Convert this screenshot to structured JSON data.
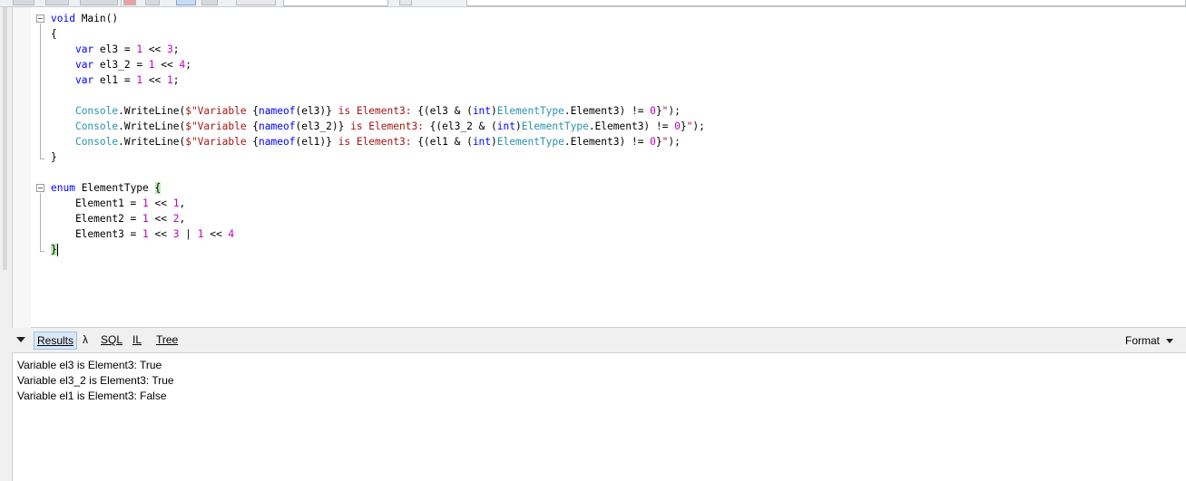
{
  "editor": {
    "lines": [
      {
        "parts": [
          {
            "t": "void",
            "c": "kw"
          },
          {
            "t": " Main()"
          }
        ]
      },
      {
        "parts": [
          {
            "t": "{"
          }
        ]
      },
      {
        "parts": [
          {
            "t": "    "
          },
          {
            "t": "var",
            "c": "kw"
          },
          {
            "t": " el3 = "
          },
          {
            "t": "1",
            "c": "num"
          },
          {
            "t": " << "
          },
          {
            "t": "3",
            "c": "num"
          },
          {
            "t": ";"
          }
        ]
      },
      {
        "parts": [
          {
            "t": "    "
          },
          {
            "t": "var",
            "c": "kw"
          },
          {
            "t": " el3_2 = "
          },
          {
            "t": "1",
            "c": "num"
          },
          {
            "t": " << "
          },
          {
            "t": "4",
            "c": "num"
          },
          {
            "t": ";"
          }
        ]
      },
      {
        "parts": [
          {
            "t": "    "
          },
          {
            "t": "var",
            "c": "kw"
          },
          {
            "t": " el1 = "
          },
          {
            "t": "1",
            "c": "num"
          },
          {
            "t": " << "
          },
          {
            "t": "1",
            "c": "num"
          },
          {
            "t": ";"
          }
        ]
      },
      {
        "parts": []
      },
      {
        "parts": [
          {
            "t": "    "
          },
          {
            "t": "Console",
            "c": "ty"
          },
          {
            "t": ".WriteLine("
          },
          {
            "t": "$\"Variable ",
            "c": "str"
          },
          {
            "t": "{"
          },
          {
            "t": "nameof",
            "c": "kw"
          },
          {
            "t": "(el3)}"
          },
          {
            "t": " is Element3: ",
            "c": "str"
          },
          {
            "t": "{(el3 & ("
          },
          {
            "t": "int",
            "c": "kw"
          },
          {
            "t": ")"
          },
          {
            "t": "ElementType",
            "c": "ty"
          },
          {
            "t": ".Element3) != "
          },
          {
            "t": "0",
            "c": "num"
          },
          {
            "t": "}"
          },
          {
            "t": "\"",
            "c": "str"
          },
          {
            "t": ");"
          }
        ]
      },
      {
        "parts": [
          {
            "t": "    "
          },
          {
            "t": "Console",
            "c": "ty"
          },
          {
            "t": ".WriteLine("
          },
          {
            "t": "$\"Variable ",
            "c": "str"
          },
          {
            "t": "{"
          },
          {
            "t": "nameof",
            "c": "kw"
          },
          {
            "t": "(el3_2)}"
          },
          {
            "t": " is Element3: ",
            "c": "str"
          },
          {
            "t": "{(el3_2 & ("
          },
          {
            "t": "int",
            "c": "kw"
          },
          {
            "t": ")"
          },
          {
            "t": "ElementType",
            "c": "ty"
          },
          {
            "t": ".Element3) != "
          },
          {
            "t": "0",
            "c": "num"
          },
          {
            "t": "}"
          },
          {
            "t": "\"",
            "c": "str"
          },
          {
            "t": ");"
          }
        ]
      },
      {
        "parts": [
          {
            "t": "    "
          },
          {
            "t": "Console",
            "c": "ty"
          },
          {
            "t": ".WriteLine("
          },
          {
            "t": "$\"Variable ",
            "c": "str"
          },
          {
            "t": "{"
          },
          {
            "t": "nameof",
            "c": "kw"
          },
          {
            "t": "(el1)}"
          },
          {
            "t": " is Element3: ",
            "c": "str"
          },
          {
            "t": "{(el1 & ("
          },
          {
            "t": "int",
            "c": "kw"
          },
          {
            "t": ")"
          },
          {
            "t": "ElementType",
            "c": "ty"
          },
          {
            "t": ".Element3) != "
          },
          {
            "t": "0",
            "c": "num"
          },
          {
            "t": "}"
          },
          {
            "t": "\"",
            "c": "str"
          },
          {
            "t": ");"
          }
        ]
      },
      {
        "parts": [
          {
            "t": "}"
          }
        ]
      },
      {
        "parts": []
      },
      {
        "parts": [
          {
            "t": "enum",
            "c": "kw"
          },
          {
            "t": " ElementType "
          },
          {
            "t": "{",
            "c": "brace"
          }
        ]
      },
      {
        "parts": [
          {
            "t": "    Element1 = "
          },
          {
            "t": "1",
            "c": "num"
          },
          {
            "t": " << "
          },
          {
            "t": "1",
            "c": "num"
          },
          {
            "t": ","
          }
        ]
      },
      {
        "parts": [
          {
            "t": "    Element2 = "
          },
          {
            "t": "1",
            "c": "num"
          },
          {
            "t": " << "
          },
          {
            "t": "2",
            "c": "num"
          },
          {
            "t": ","
          }
        ]
      },
      {
        "parts": [
          {
            "t": "    Element3 = "
          },
          {
            "t": "1",
            "c": "num"
          },
          {
            "t": " << "
          },
          {
            "t": "3",
            "c": "num"
          },
          {
            "t": " | "
          },
          {
            "t": "1",
            "c": "num"
          },
          {
            "t": " << "
          },
          {
            "t": "4",
            "c": "num"
          }
        ]
      },
      {
        "parts": [
          {
            "t": "}",
            "c": "brace"
          }
        ]
      }
    ]
  },
  "results_bar": {
    "tabs": [
      {
        "label": "Results",
        "name": "tab-results",
        "active": true
      },
      {
        "label": "λ",
        "name": "tab-lambda",
        "active": false
      },
      {
        "label": "SQL",
        "name": "tab-sql",
        "active": false
      },
      {
        "label": "IL",
        "name": "tab-il",
        "active": false
      },
      {
        "label": "Tree",
        "name": "tab-tree",
        "active": false
      }
    ],
    "format_label": "Format"
  },
  "output": {
    "lines": [
      "Variable el3 is Element3: True",
      "Variable el3_2 is Element3: True",
      "Variable el1 is Element3: False"
    ]
  }
}
